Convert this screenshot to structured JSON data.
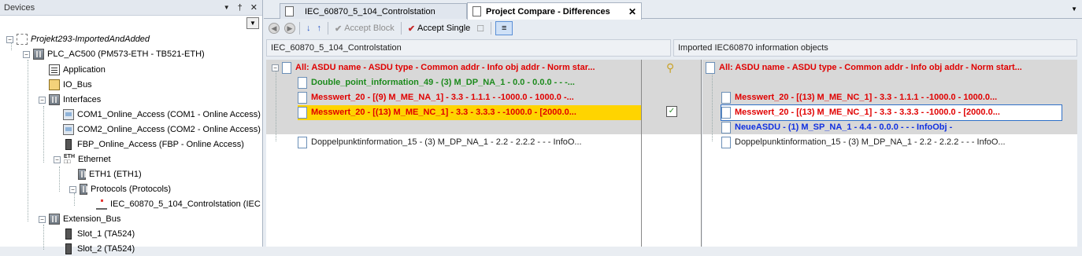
{
  "devices": {
    "title": "Devices",
    "pin_label": "↓  ↓",
    "ctrl_dropdown": "▼",
    "ctrl_pin": "†",
    "ctrl_close": "✕",
    "tree": [
      {
        "label": "Projekt293-ImportedAndAdded",
        "icon": "project-icon"
      },
      {
        "label": "PLC_AC500 (PM573-ETH - TB521-ETH)",
        "icon": "plc-icon"
      },
      {
        "label": "Application",
        "icon": "application-icon"
      },
      {
        "label": "IO_Bus",
        "icon": "io-bus-icon"
      },
      {
        "label": "Interfaces",
        "icon": "interfaces-icon"
      },
      {
        "label": "COM1_Online_Access (COM1 - Online Access)",
        "icon": "com-port-icon"
      },
      {
        "label": "COM2_Online_Access (COM2 - Online Access)",
        "icon": "com-port-icon"
      },
      {
        "label": "FBP_Online_Access (FBP - Online Access)",
        "icon": "fbp-icon"
      },
      {
        "label": "Ethernet",
        "icon": "ethernet-icon"
      },
      {
        "label": "ETH1 (ETH1)",
        "icon": "eth-port-icon"
      },
      {
        "label": "Protocols (Protocols)",
        "icon": "protocols-icon"
      },
      {
        "label": "IEC_60870_5_104_Controlstation (IEC",
        "icon": "network-icon"
      },
      {
        "label": "Extension_Bus",
        "icon": "extension-bus-icon"
      },
      {
        "label": "Slot_1 (TA524)",
        "icon": "slot-icon"
      },
      {
        "label": "Slot_2 (TA524)",
        "icon": "slot-icon"
      }
    ]
  },
  "tabs": [
    {
      "label": "IEC_60870_5_104_Controlstation"
    },
    {
      "label": "Project Compare - Differences",
      "close": "✕"
    }
  ],
  "tab_menu": "▼",
  "toolbar": {
    "back": "◀",
    "forward": "▶",
    "next_diff": "↓",
    "prev_diff": "↑",
    "accept_block": "Accept Block",
    "accept_single": "Accept Single",
    "check": "✔"
  },
  "left_path": "IEC_60870_5_104_Controlstation",
  "right_path": "Imported IEC60870 information objects",
  "left_rows": [
    {
      "text": "All: ASDU name  -  ASDU type  -  Common addr  -  Info obj addr  -  Norm star...",
      "style": "hdrrow"
    },
    {
      "text": "Double_point_information_49  -  (3) M_DP_NA_1  -  0.0  -  0.0.0  -    -   -...",
      "style": "green"
    },
    {
      "text": "Messwert_20  -  [(9) M_ME_NA_1]  -  3.3  -  1.1.1  -  -1000.0  -  1000.0  -...",
      "style": "red"
    },
    {
      "text": "Messwert_20  -  [(13) M_ME_NC_1]  -  3.3  -  3.3.3  -  -1000.0  -  [2000.0...",
      "style": "red hl"
    },
    {
      "text": "",
      "style": "empty"
    },
    {
      "text": "Doppelpunktinformation_15  -  (3) M_DP_NA_1  -  2.2  -  2.2.2  -    -    -   InfoO...",
      "style": "plain"
    }
  ],
  "right_rows": [
    {
      "text": "All: ASDU name  -  ASDU type  -  Common addr  -  Info obj addr  -  Norm start...",
      "style": "hdrrow"
    },
    {
      "text": "",
      "style": "empty"
    },
    {
      "text": "Messwert_20  -  [(13) M_ME_NC_1]  -  3.3  -  1.1.1  -  -1000.0  -  1000.0...",
      "style": "red"
    },
    {
      "text": "Messwert_20  -  [(13) M_ME_NC_1]  -  3.3  -  3.3.3  -  -1000.0  -  [2000.0...",
      "style": "red boxed"
    },
    {
      "text": "NeueASDU  -  (1) M_SP_NA_1  -  4.4  -  0.0.0  -    -    -   InfoObj  -",
      "style": "blue"
    },
    {
      "text": "Doppelpunktinformation_15  -  (3) M_DP_NA_1  -  2.2  -  2.2.2  -    -    -   InfoO...",
      "style": "plain"
    }
  ]
}
